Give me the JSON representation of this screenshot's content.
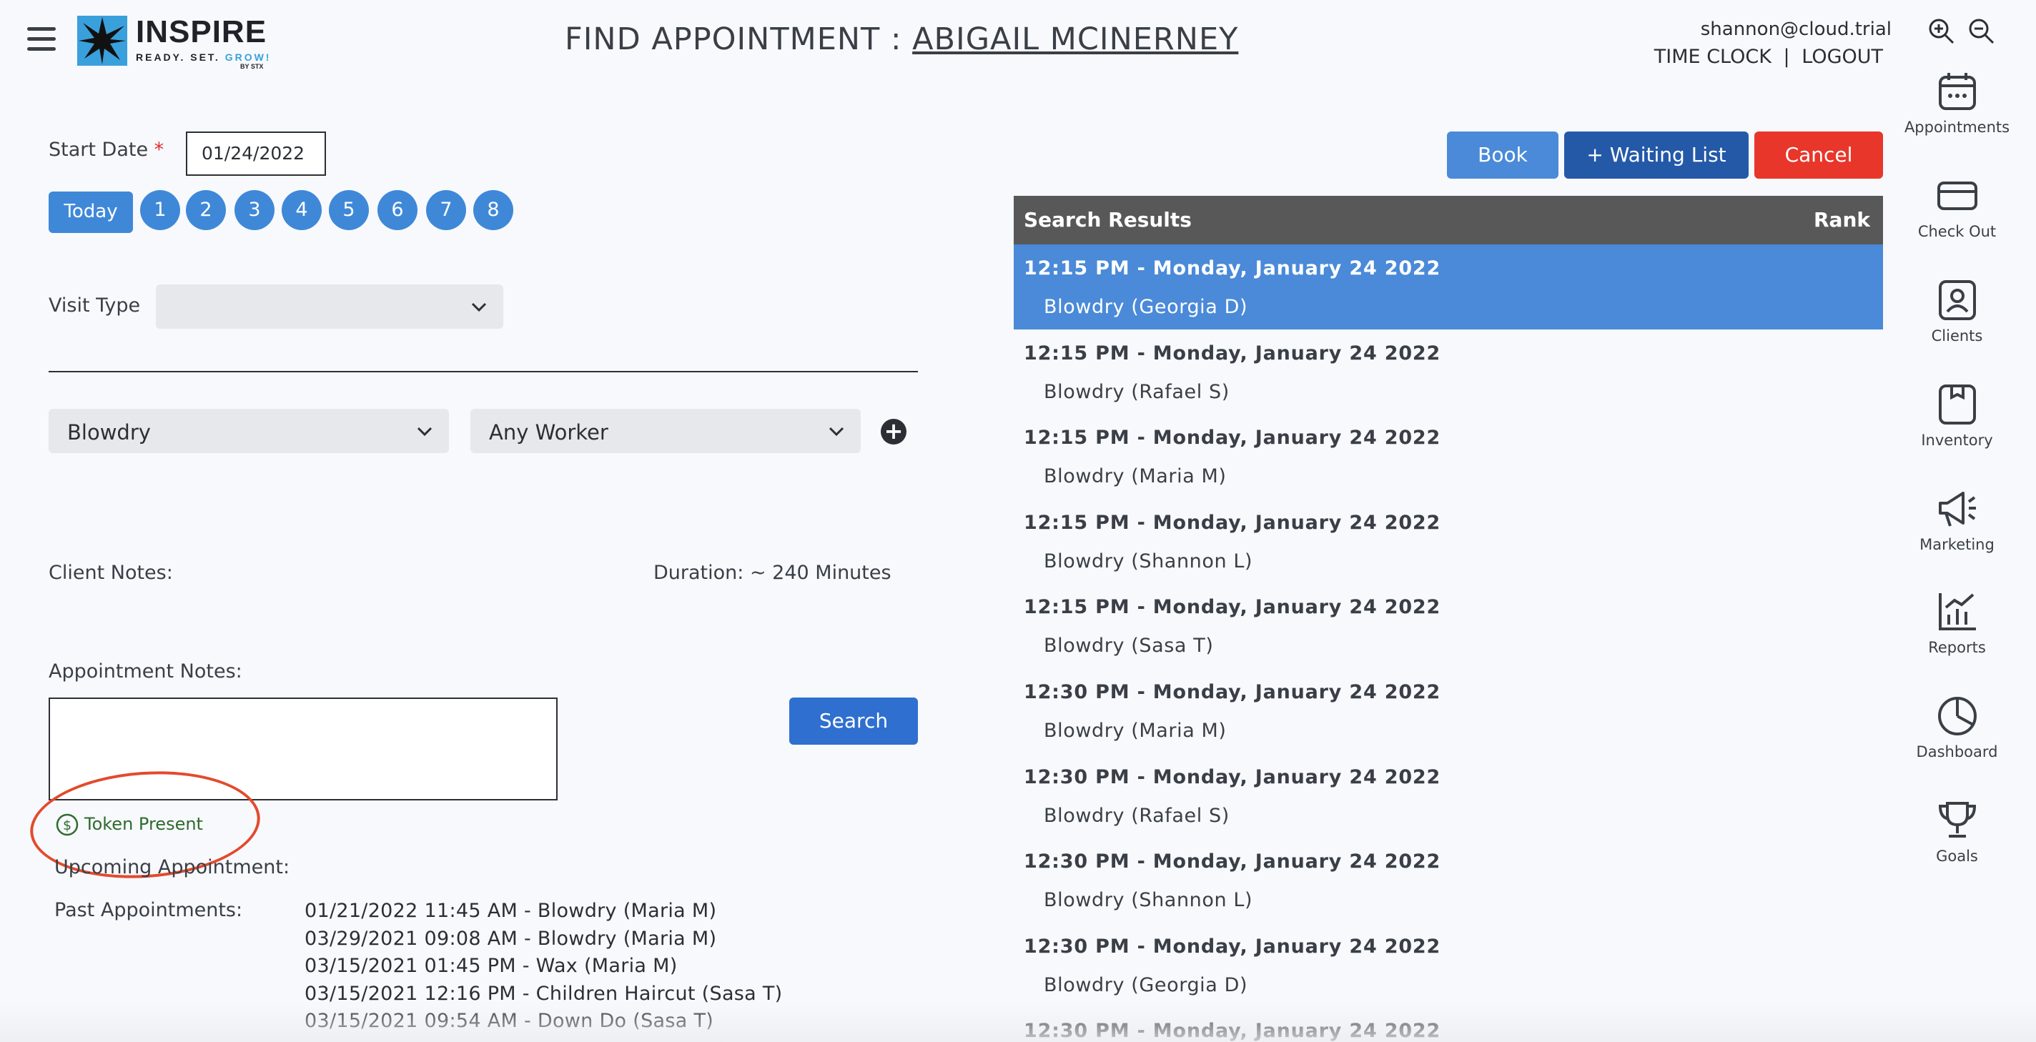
{
  "header": {
    "logo_name": "INSPIRE",
    "logo_tagline_1": "READY. SET.",
    "logo_tagline_2": "GROW!",
    "logo_by": "BY STX",
    "title_prefix": "FIND APPOINTMENT : ",
    "client_name": "ABIGAIL MCINERNEY",
    "user_email": "shannon@cloud.trial",
    "time_clock": "TIME CLOCK",
    "separator": "|",
    "logout": "LOGOUT"
  },
  "nav": [
    {
      "label": "Appointments",
      "icon": "calendar-icon"
    },
    {
      "label": "Check Out",
      "icon": "card-icon"
    },
    {
      "label": "Clients",
      "icon": "client-icon"
    },
    {
      "label": "Inventory",
      "icon": "box-icon"
    },
    {
      "label": "Marketing",
      "icon": "megaphone-icon"
    },
    {
      "label": "Reports",
      "icon": "chart-icon"
    },
    {
      "label": "Dashboard",
      "icon": "pie-icon"
    },
    {
      "label": "Goals",
      "icon": "trophy-icon"
    }
  ],
  "form": {
    "start_date_label": "Start Date",
    "required_mark": "*",
    "start_date_value": "01/24/2022",
    "today_label": "Today",
    "day_buttons": [
      "1",
      "2",
      "3",
      "4",
      "5",
      "6",
      "7",
      "8"
    ],
    "visit_type_label": "Visit Type",
    "visit_type_value": "",
    "service_value": "Blowdry",
    "worker_value": "Any Worker",
    "add_label": "+",
    "client_notes_label": "Client Notes:",
    "duration_text": "Duration: ~ 240 Minutes",
    "appointment_notes_label": "Appointment Notes:",
    "search_label": "Search",
    "token_label": "Token Present",
    "upcoming_label": "Upcoming Appointment:",
    "past_label": "Past Appointments:",
    "past_appointments": [
      "01/21/2022 11:45 AM - Blowdry (Maria M)",
      "03/29/2021 09:08 AM - Blowdry (Maria M)",
      "03/15/2021 01:45 PM - Wax (Maria M)",
      "03/15/2021 12:16 PM - Children Haircut (Sasa T)",
      "03/15/2021 09:54 AM - Down Do (Sasa T)"
    ]
  },
  "actions": {
    "book": "Book",
    "waiting_list": "+ Waiting List",
    "cancel": "Cancel"
  },
  "results": {
    "header": "Search Results",
    "rank_header": "Rank",
    "rows": [
      {
        "time": "12:15 PM - Monday, January 24 2022",
        "service": "Blowdry (Georgia D)",
        "selected": true
      },
      {
        "time": "12:15 PM - Monday, January 24 2022",
        "service": "Blowdry (Rafael S)"
      },
      {
        "time": "12:15 PM - Monday, January 24 2022",
        "service": "Blowdry (Maria M)"
      },
      {
        "time": "12:15 PM - Monday, January 24 2022",
        "service": "Blowdry (Shannon L)"
      },
      {
        "time": "12:15 PM - Monday, January 24 2022",
        "service": "Blowdry (Sasa T)"
      },
      {
        "time": "12:30 PM - Monday, January 24 2022",
        "service": "Blowdry (Maria M)"
      },
      {
        "time": "12:30 PM - Monday, January 24 2022",
        "service": "Blowdry (Rafael S)"
      },
      {
        "time": "12:30 PM - Monday, January 24 2022",
        "service": "Blowdry (Shannon L)"
      },
      {
        "time": "12:30 PM - Monday, January 24 2022",
        "service": "Blowdry (Georgia D)"
      },
      {
        "time": "12:30 PM - Monday, January 24 2022",
        "service": ""
      }
    ]
  },
  "colors": {
    "primary": "#3f88d8",
    "dark_blue": "#2459a8",
    "cancel_red": "#e8362a",
    "annotation": "#e34a2c",
    "token_green": "#2e6b2e"
  }
}
